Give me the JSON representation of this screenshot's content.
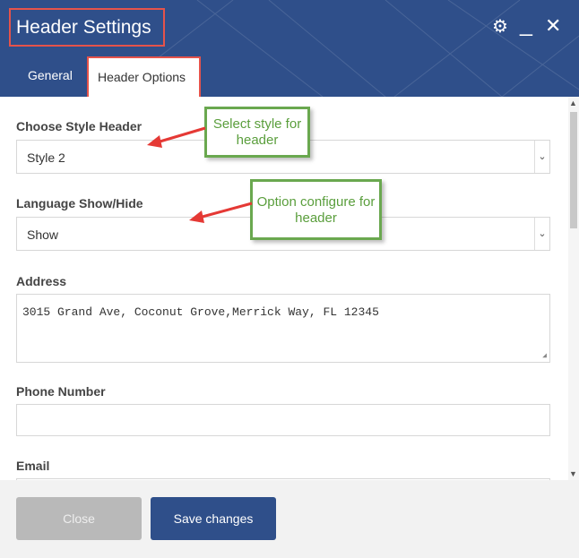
{
  "window": {
    "title": "Header Settings",
    "icons": [
      "gear-icon",
      "minimize-icon",
      "close-icon"
    ]
  },
  "tabs": [
    {
      "label": "General",
      "active": false
    },
    {
      "label": "Header Options",
      "active": true
    }
  ],
  "fields": {
    "style_header": {
      "label": "Choose Style Header",
      "value": "Style 2"
    },
    "language": {
      "label": "Language Show/Hide",
      "value": "Show"
    },
    "address": {
      "label": "Address",
      "value": "3015 Grand Ave, Coconut Grove,Merrick Way, FL 12345"
    },
    "phone": {
      "label": "Phone Number",
      "value": ""
    },
    "email": {
      "label": "Email",
      "value": ""
    }
  },
  "annotations": {
    "style_note": "Select style for header",
    "option_note": "Option configure for header"
  },
  "buttons": {
    "close": "Close",
    "save": "Save changes"
  },
  "colors": {
    "header": "#2f4f8a",
    "highlight": "#e5534b",
    "callout": "#6aa84f",
    "arrow": "#e53935"
  }
}
